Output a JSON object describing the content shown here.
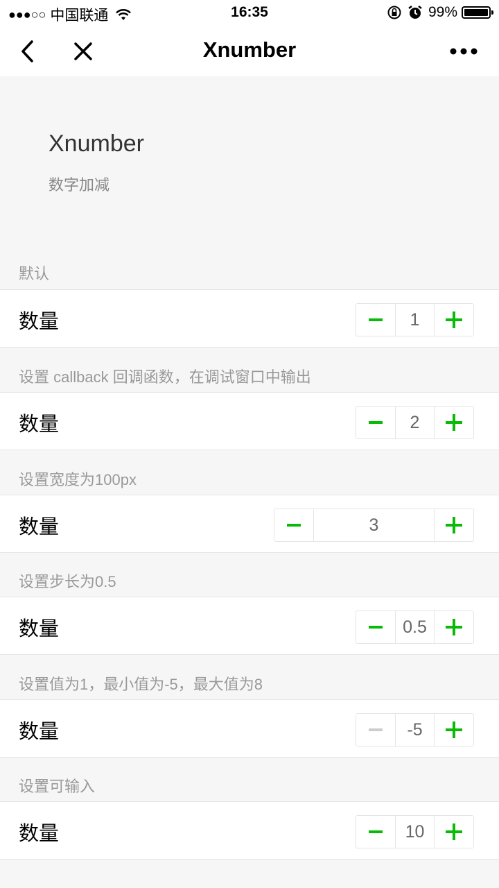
{
  "status_bar": {
    "signal": "●●●○○",
    "carrier": "中国联通",
    "time": "16:35",
    "battery": "99%",
    "battery_level": 0.99
  },
  "nav": {
    "title": "Xnumber",
    "back_icon": "chevron-left-icon",
    "close_icon": "close-icon",
    "more_icon": "more-dots-icon"
  },
  "header": {
    "title": "Xnumber",
    "description": "数字加减"
  },
  "colors": {
    "accent": "#09bb07",
    "disabled": "#cccccc"
  },
  "sections": [
    {
      "label": "默认",
      "row_label": "数量",
      "value": "1",
      "minus_disabled": false
    },
    {
      "label": "设置 callback 回调函数，在调试窗口中输出",
      "row_label": "数量",
      "value": "2",
      "minus_disabled": false
    },
    {
      "label": "设置宽度为100px",
      "row_label": "数量",
      "value": "3",
      "minus_disabled": false,
      "wide": true
    },
    {
      "label": "设置步长为0.5",
      "row_label": "数量",
      "value": "0.5",
      "minus_disabled": false
    },
    {
      "label": "设置值为1，最小值为-5，最大值为8",
      "row_label": "数量",
      "value": "-5",
      "minus_disabled": true
    },
    {
      "label": "设置可输入",
      "row_label": "数量",
      "value": "10",
      "minus_disabled": false
    }
  ]
}
